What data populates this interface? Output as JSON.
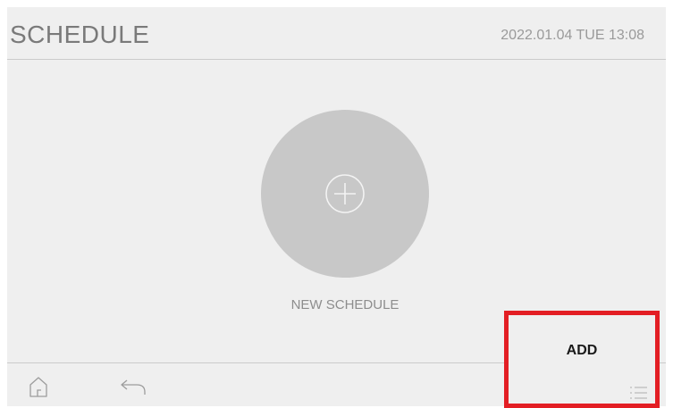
{
  "header": {
    "title": "SCHEDULE",
    "datetime": "2022.01.04 TUE 13:08"
  },
  "main": {
    "new_schedule_label": "NEW SCHEDULE",
    "new_schedule_icon": "plus-circle-icon"
  },
  "footer": {
    "home_icon": "home-icon",
    "back_icon": "back-arrow-icon"
  },
  "add_panel": {
    "label": "ADD",
    "icon": "list-icon",
    "highlight_color": "#e31e24"
  },
  "colors": {
    "background": "#efefef",
    "circle": "#c8c8c8",
    "title_text": "#7a7a7a"
  }
}
